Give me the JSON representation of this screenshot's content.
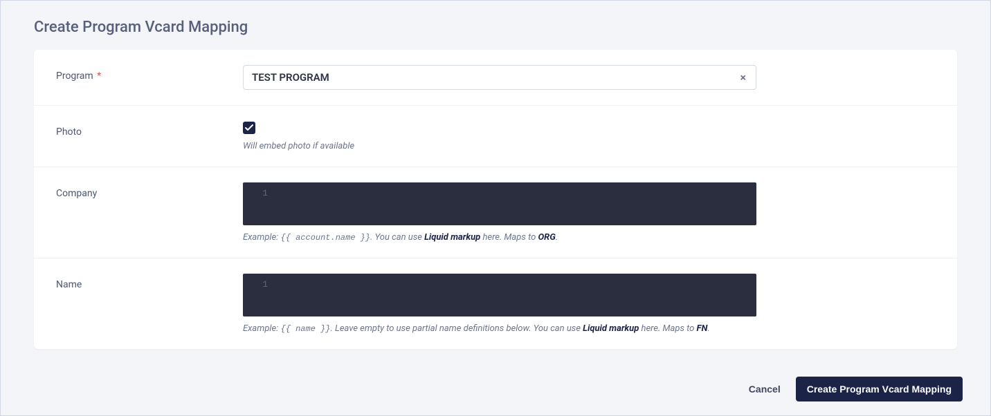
{
  "page_title": "Create Program Vcard Mapping",
  "form": {
    "program": {
      "label": "Program",
      "required_mark": "*",
      "value": "TEST PROGRAM"
    },
    "photo": {
      "label": "Photo",
      "checked": true,
      "hint": "Will embed photo if available"
    },
    "company": {
      "label": "Company",
      "line_no": "1",
      "hint_prefix": "Example: ",
      "hint_code": "{{ account.name }}",
      "hint_mid1": ". You can use ",
      "hint_link1": "Liquid markup",
      "hint_mid2": " here. Maps to ",
      "hint_link2": "ORG",
      "hint_end": "."
    },
    "name": {
      "label": "Name",
      "line_no": "1",
      "hint_prefix": "Example: ",
      "hint_code": "{{ name }}",
      "hint_mid1": ". Leave empty to use partial name definitions below. You can use ",
      "hint_link1": "Liquid markup",
      "hint_mid2": " here. Maps to ",
      "hint_link2": "FN",
      "hint_end": "."
    }
  },
  "actions": {
    "cancel": "Cancel",
    "submit": "Create Program Vcard Mapping"
  }
}
